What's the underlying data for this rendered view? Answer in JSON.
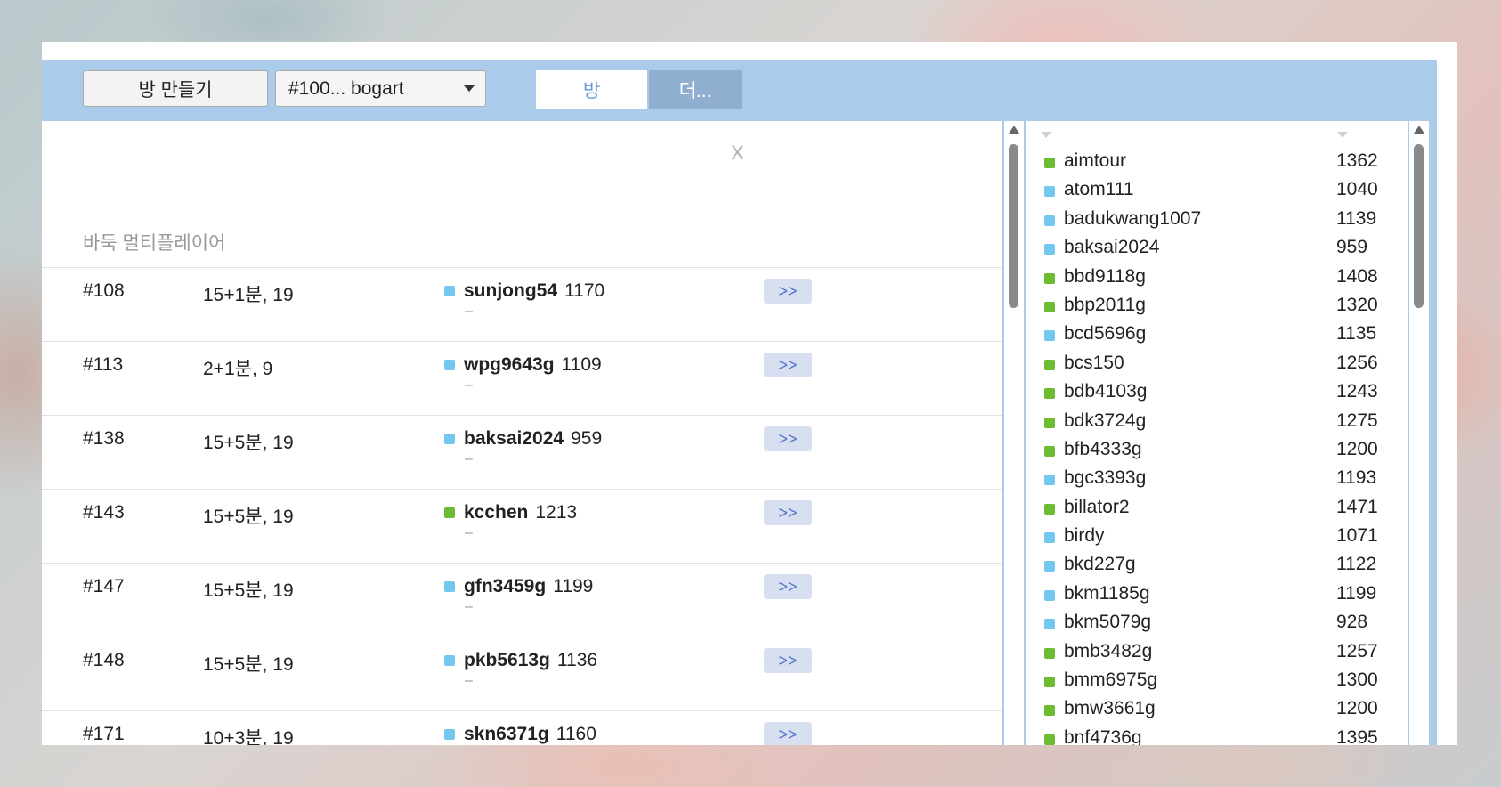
{
  "toolbar": {
    "create_room_label": "방 만들기",
    "room_select_value": "#100... bogart",
    "tabs": [
      {
        "label": "방",
        "active": true
      },
      {
        "label": "더...",
        "active": false
      }
    ]
  },
  "left_panel": {
    "close_label": "X",
    "section_title": "바둑 멀티플레이어",
    "join_label": ">>",
    "rooms": [
      {
        "id": "#108",
        "time": "15+1분, 19",
        "status": "blue",
        "player": "sunjong54",
        "rating": "1170",
        "sub": "–"
      },
      {
        "id": "#113",
        "time": "2+1분, 9",
        "status": "blue",
        "player": "wpg9643g",
        "rating": "1109",
        "sub": "–"
      },
      {
        "id": "#138",
        "time": "15+5분, 19",
        "status": "blue",
        "player": "baksai2024",
        "rating": "959",
        "sub": "–"
      },
      {
        "id": "#143",
        "time": "15+5분, 19",
        "status": "green",
        "player": "kcchen",
        "rating": "1213",
        "sub": "–"
      },
      {
        "id": "#147",
        "time": "15+5분, 19",
        "status": "blue",
        "player": "gfn3459g",
        "rating": "1199",
        "sub": "–"
      },
      {
        "id": "#148",
        "time": "15+5분, 19",
        "status": "blue",
        "player": "pkb5613g",
        "rating": "1136",
        "sub": "–"
      },
      {
        "id": "#171",
        "time": "10+3분, 19",
        "status": "blue",
        "player": "skn6371g",
        "rating": "1160",
        "sub": "–"
      }
    ]
  },
  "user_list": [
    {
      "name": "aimtour",
      "rating": "1362",
      "flag": "#",
      "status": "green"
    },
    {
      "name": "atom111",
      "rating": "1040",
      "flag": "",
      "status": "blue"
    },
    {
      "name": "badukwang1007",
      "rating": "1139",
      "flag": "#",
      "status": "blue"
    },
    {
      "name": "baksai2024",
      "rating": "959",
      "flag": "#",
      "status": "blue"
    },
    {
      "name": "bbd9118g",
      "rating": "1408",
      "flag": "#",
      "status": "green"
    },
    {
      "name": "bbp2011g",
      "rating": "1320",
      "flag": "#",
      "status": "green"
    },
    {
      "name": "bcd5696g",
      "rating": "1135",
      "flag": "#",
      "status": "blue"
    },
    {
      "name": "bcs150",
      "rating": "1256",
      "flag": "#",
      "status": "green"
    },
    {
      "name": "bdb4103g",
      "rating": "1243",
      "flag": "",
      "status": "green"
    },
    {
      "name": "bdk3724g",
      "rating": "1275",
      "flag": "#",
      "status": "green"
    },
    {
      "name": "bfb4333g",
      "rating": "1200",
      "flag": "#",
      "status": "green"
    },
    {
      "name": "bgc3393g",
      "rating": "1193",
      "flag": "#",
      "status": "blue"
    },
    {
      "name": "billator2",
      "rating": "1471",
      "flag": "",
      "status": "green"
    },
    {
      "name": "birdy",
      "rating": "1071",
      "flag": "",
      "status": "blue"
    },
    {
      "name": "bkd227g",
      "rating": "1122",
      "flag": "",
      "status": "blue"
    },
    {
      "name": "bkm1185g",
      "rating": "1199",
      "flag": "#",
      "status": "blue"
    },
    {
      "name": "bkm5079g",
      "rating": "928",
      "flag": "#",
      "status": "blue"
    },
    {
      "name": "bmb3482g",
      "rating": "1257",
      "flag": "#",
      "status": "green"
    },
    {
      "name": "bmm6975g",
      "rating": "1300",
      "flag": "#",
      "status": "green"
    },
    {
      "name": "bmw3661g",
      "rating": "1200",
      "flag": "#",
      "status": "green"
    },
    {
      "name": "bnf4736g",
      "rating": "1395",
      "flag": "#",
      "status": "green"
    }
  ],
  "colors": {
    "toolbar_bg": "#abcbea",
    "status_blue": "#74c8ef",
    "status_green": "#6cbc34",
    "join_button_bg": "#d8dff0",
    "tab_more_bg": "#8faed0"
  }
}
